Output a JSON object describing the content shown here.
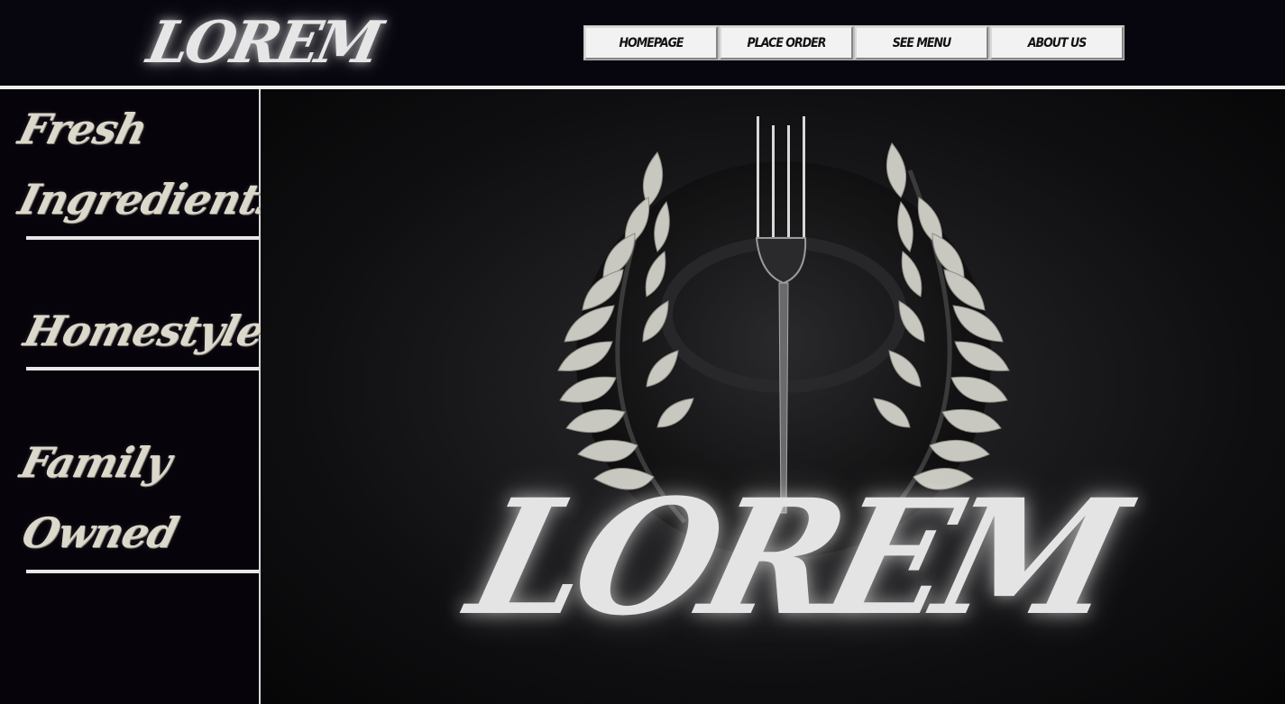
{
  "header": {
    "logo_text": "LOREM"
  },
  "nav": {
    "items": [
      {
        "label": "HOMEPAGE"
      },
      {
        "label": "PLACE ORDER"
      },
      {
        "label": "SEE MENU"
      },
      {
        "label": "ABOUT US"
      }
    ]
  },
  "sidebar": {
    "taglines": [
      {
        "lines": [
          "Fresh",
          "Ingredients"
        ]
      },
      {
        "lines": [
          "Homestyle"
        ]
      },
      {
        "lines": [
          "Family",
          "Owned"
        ]
      }
    ]
  },
  "hero": {
    "wordmark": "LOREM",
    "emblem": "fork-laurel-icon"
  },
  "colors": {
    "background": "#06040a",
    "text": "#e6e6e6",
    "button": "#f2f2f2",
    "button_text": "#111111"
  }
}
